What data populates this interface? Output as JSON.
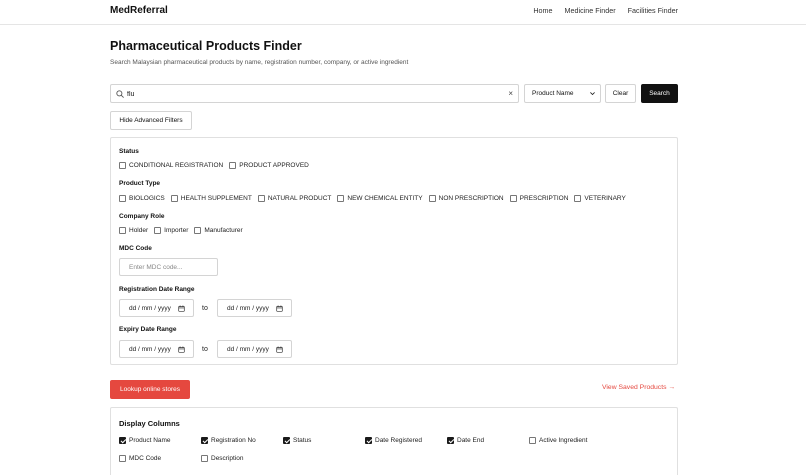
{
  "nav": {
    "brand": "MedReferral",
    "links": [
      "Home",
      "Medicine Finder",
      "Facilities Finder"
    ]
  },
  "header": {
    "title": "Pharmaceutical Products Finder",
    "subtitle": "Search Malaysian pharmaceutical products by name, registration number, company, or active ingredient"
  },
  "search": {
    "value": "flu",
    "clear_symbol": "×",
    "field_select": "Product Name",
    "clear_label": "Clear",
    "search_label": "Search"
  },
  "advanced_toggle_label": "Hide Advanced Filters",
  "filters": {
    "status": {
      "label": "Status",
      "options": [
        {
          "label": "CONDITIONAL REGISTRATION",
          "checked": false
        },
        {
          "label": "PRODUCT APPROVED",
          "checked": false
        }
      ]
    },
    "product_type": {
      "label": "Product Type",
      "options": [
        {
          "label": "BIOLOGICS",
          "checked": false
        },
        {
          "label": "HEALTH SUPPLEMENT",
          "checked": false
        },
        {
          "label": "NATURAL PRODUCT",
          "checked": false
        },
        {
          "label": "NEW CHEMICAL ENTITY",
          "checked": false
        },
        {
          "label": "NON PRESCRIPTION",
          "checked": false
        },
        {
          "label": "PRESCRIPTION",
          "checked": false
        },
        {
          "label": "VETERINARY",
          "checked": false
        }
      ]
    },
    "company_role": {
      "label": "Company Role",
      "options": [
        {
          "label": "Holder",
          "checked": false
        },
        {
          "label": "Importer",
          "checked": false
        },
        {
          "label": "Manufacturer",
          "checked": false
        }
      ]
    },
    "mdc_code": {
      "label": "MDC Code",
      "placeholder": "Enter MDC code..."
    },
    "registration_date": {
      "label": "Registration Date Range",
      "from": "dd / mm / yyyy",
      "to_label": "to",
      "to": "dd / mm / yyyy"
    },
    "expiry_date": {
      "label": "Expiry Date Range",
      "from": "dd / mm / yyyy",
      "to_label": "to",
      "to": "dd / mm / yyyy"
    }
  },
  "lookup_label": "Lookup online stores",
  "saved_link": "View Saved Products →",
  "display_columns": {
    "title": "Display Columns",
    "items": [
      {
        "label": "Product Name",
        "checked": true
      },
      {
        "label": "Registration No",
        "checked": true
      },
      {
        "label": "Status",
        "checked": true
      },
      {
        "label": "Date Registered",
        "checked": true
      },
      {
        "label": "Date End",
        "checked": true
      },
      {
        "label": "Active Ingredient",
        "checked": false
      },
      {
        "label": "MDC Code",
        "checked": false
      },
      {
        "label": "Description",
        "checked": false
      }
    ]
  },
  "colors": {
    "primary_dark": "#111111",
    "accent_red": "#e5483f",
    "border": "#d4d4d4"
  }
}
